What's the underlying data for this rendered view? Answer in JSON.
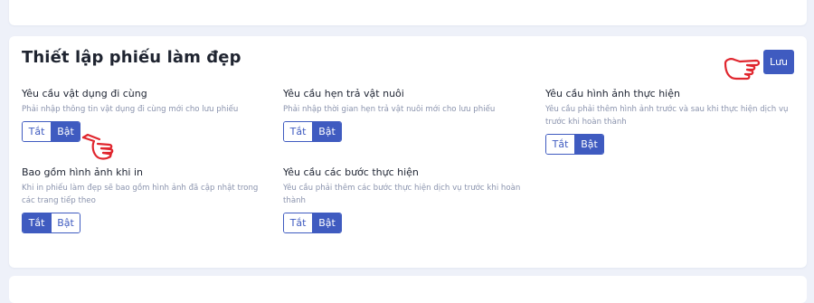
{
  "form": {
    "title": "Thiết lập phiếu làm đẹp",
    "save_label": "Lưu",
    "settings": [
      {
        "label": "Yêu cầu vật dụng đi cùng",
        "description": "Phải nhập thông tin vật dụng đi cùng mới cho lưu phiếu",
        "off_label": "Tắt",
        "on_label": "Bật",
        "state": "on"
      },
      {
        "label": "Yêu cầu hẹn trả vật nuôi",
        "description": "Phải nhập thời gian hẹn trả vật nuôi mới cho lưu phiếu",
        "off_label": "Tắt",
        "on_label": "Bật",
        "state": "on"
      },
      {
        "label": "Yêu cầu hình ảnh thực hiện",
        "description": "Yêu cầu phải thêm hình ảnh trước và sau khi thực hiện dịch vụ trước khi hoàn thành",
        "off_label": "Tắt",
        "on_label": "Bật",
        "state": "on"
      },
      {
        "label": "Bao gồm hình ảnh khi in",
        "description": "Khi in phiếu làm đẹp sẽ bao gồm hình ảnh đã cập nhật trong các trang tiếp theo",
        "off_label": "Tắt",
        "on_label": "Bật",
        "state": "off"
      },
      {
        "label": "Yêu cầu các bước thực hiện",
        "description": "Yêu cầu phải thêm các bước thực hiện dịch vụ trước khi hoàn thành",
        "off_label": "Tắt",
        "on_label": "Bật",
        "state": "on"
      }
    ]
  },
  "colors": {
    "accent": "#3f5bc0",
    "page_background": "#eef1f9",
    "hand_pointer": "#e0262e"
  },
  "icons": [
    "pointing-hand-icon"
  ]
}
